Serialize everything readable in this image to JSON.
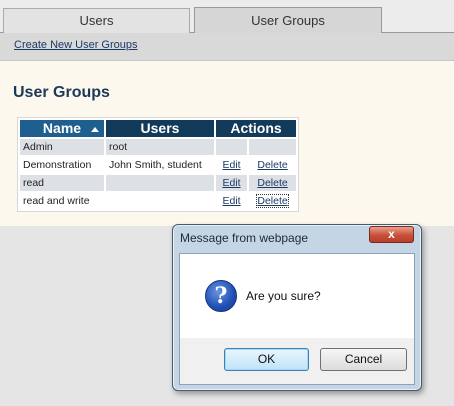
{
  "tabs": [
    {
      "label": "Users"
    },
    {
      "label": "User Groups"
    }
  ],
  "subbar": {
    "create_link": "Create New User Groups"
  },
  "page": {
    "heading": "User Groups"
  },
  "table": {
    "headers": {
      "name": "Name",
      "users": "Users",
      "actions": "Actions"
    },
    "rows": [
      {
        "name": "Admin",
        "users": "root",
        "edit": "",
        "delete": ""
      },
      {
        "name": "Demonstration",
        "users": "John Smith, student",
        "edit": "Edit",
        "delete": "Delete"
      },
      {
        "name": "read",
        "users": "",
        "edit": "Edit",
        "delete": "Delete"
      },
      {
        "name": "read and write",
        "users": "",
        "edit": "Edit",
        "delete": "Delete"
      }
    ]
  },
  "dialog": {
    "title": "Message from webpage",
    "close_label": "x",
    "message": "Are you sure?",
    "ok_label": "OK",
    "cancel_label": "Cancel"
  }
}
